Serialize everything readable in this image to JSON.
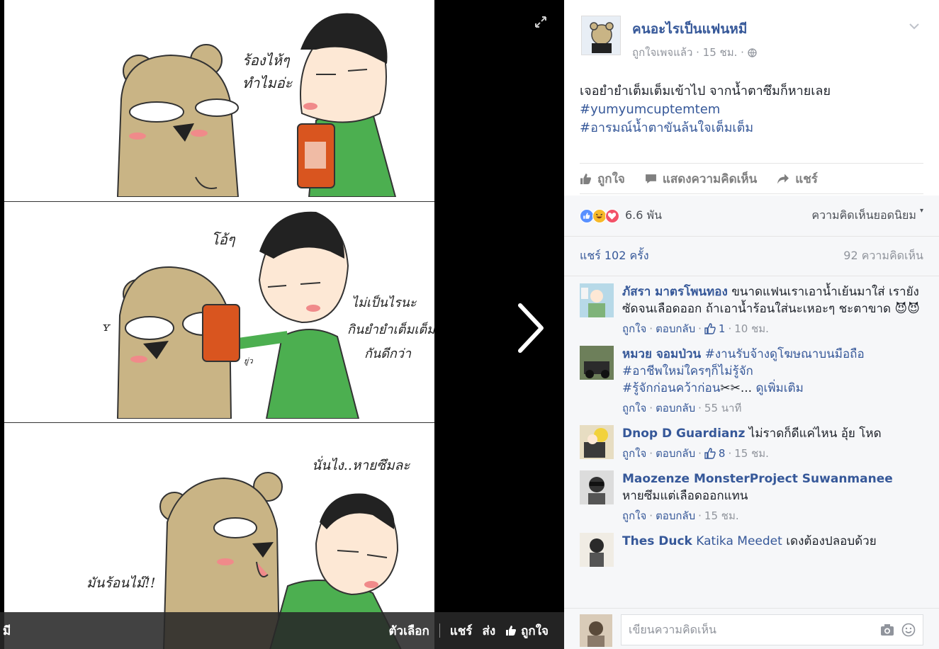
{
  "viewer": {
    "bar_left": "มี",
    "options_label": "ตัวเลือก",
    "share_label": "แชร์",
    "send_label": "ส่ง",
    "like_label": "ถูกใจ"
  },
  "comic": {
    "panel1_text": [
      "ร้องไห้ๆ",
      "ทำไมอ่ะ"
    ],
    "panel2_text_left": "โอ้ๆ",
    "panel2_text_right": [
      "ไม่เป็นไรนะ",
      "กินยำยำเต็มเต็ม",
      "กันดีกว่า"
    ],
    "panel2_small": "ยู่ว",
    "panel3_text_top": "นั่นไง..หายซึมละ",
    "panel3_text_left": "มันร้อนไม๊!!"
  },
  "post": {
    "page_name": "คนอะไรเป็นแฟนหมี",
    "meta": "ถูกใจเพจแล้ว · 15 ชม. ·",
    "text": "เจอยำยำเต็มเต็มเข้าไป จากน้ำตาซึมก็หายเลย",
    "hashtags": [
      "#yumyumcuptemtem",
      "#อารมณ์น้ำตาขันล้นใจเต็มเต็ม"
    ],
    "actions": {
      "like": "ถูกใจ",
      "comment": "แสดงความคิดเห็น",
      "share": "แชร์"
    },
    "reaction_count": "6.6 พัน",
    "top_comments": "ความคิดเห็นยอดนิยม",
    "share_count": "แชร์ 102 ครั้ง",
    "comment_count": "92 ความคิดเห็น"
  },
  "comments": [
    {
      "name": "ภัสรา มาตรโพนทอง",
      "text": "ขนาดแฟนเราเอาน้ำเย้นมาใส่ เรายังซัดจนเลือดออก ถ้าเอาน้ำร้อนใส่นะเหอะๆ ชะตาขาด",
      "emoji": "😈😈",
      "like": "ถูกใจ",
      "reply": "ตอบกลับ",
      "likes": "1",
      "time": "10 ชม."
    },
    {
      "name": "หมวย จอมป่วน",
      "text_tag1": "#งานรับจ้างดูโฆษณาบนมือถือ",
      "text_tag2": "#อาชีพใหม่ใครๆก็ไม่รู้จัก",
      "text_tag3": "#รู้จักก่อนคว้าก่อน",
      "ellipsis": "...",
      "see_more": "ดูเพิ่มเติม",
      "like": "ถูกใจ",
      "reply": "ตอบกลับ",
      "time": "55 นาที"
    },
    {
      "name": "Dnop D Guardianz",
      "text": "ไม่ราดก็ดีแค่ไหน อุ้ย โหด",
      "like": "ถูกใจ",
      "reply": "ตอบกลับ",
      "likes": "8",
      "time": "15 ชม."
    },
    {
      "name": "Maozenze MonsterProject Suwanmanee",
      "text": "หายซึมแต่เลือดออกแทน",
      "like": "ถูกใจ",
      "reply": "ตอบกลับ",
      "time": "15 ชม."
    },
    {
      "name": "Thes Duck",
      "mention": "Katika Meedet",
      "text": "เดงต้องปลอบด้วย"
    }
  ],
  "comment_input": {
    "placeholder": "เขียนความคิดเห็น"
  },
  "colors": {
    "link": "#365899",
    "like_blue": "#5890ff",
    "haha_yellow": "#f7b928",
    "love_red": "#f25268",
    "shirt_green": "#4caf50",
    "bear_tan": "#c9b485"
  },
  "icons": [
    "expand-icon",
    "chevron-right-icon",
    "chevron-down-icon",
    "globe-icon",
    "thumbs-up-icon",
    "comment-icon",
    "share-icon",
    "camera-icon",
    "emoji-icon"
  ]
}
